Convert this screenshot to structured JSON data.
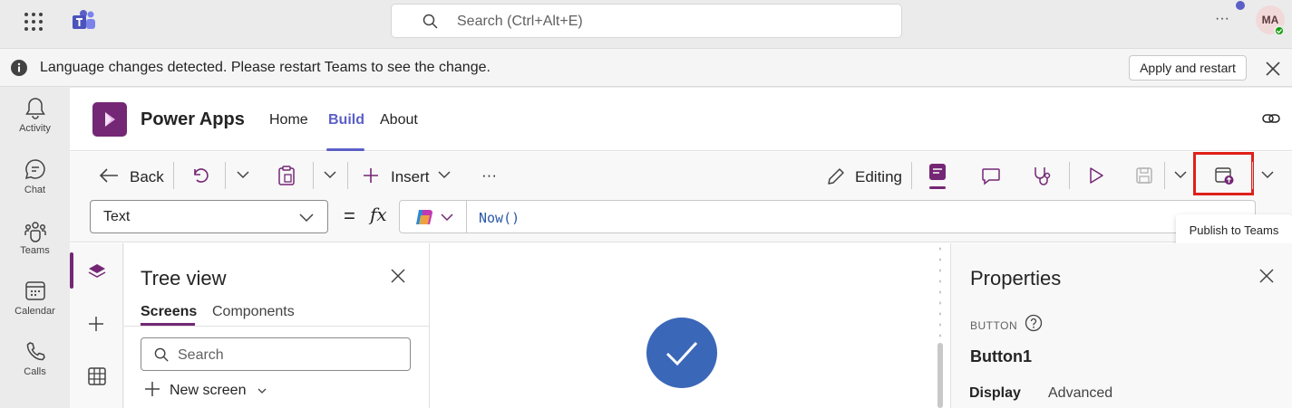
{
  "topbar": {
    "search_placeholder": "Search (Ctrl+Alt+E)",
    "more_label": "···",
    "avatar_initials": "MA"
  },
  "banner": {
    "message": "Language changes detected. Please restart Teams to see the change.",
    "apply_label": "Apply and restart"
  },
  "rail": {
    "items": [
      {
        "label": "Activity",
        "icon": "bell-icon"
      },
      {
        "label": "Chat",
        "icon": "chat-icon"
      },
      {
        "label": "Teams",
        "icon": "teams-icon"
      },
      {
        "label": "Calendar",
        "icon": "calendar-icon"
      },
      {
        "label": "Calls",
        "icon": "phone-icon"
      }
    ]
  },
  "app": {
    "name": "Power Apps",
    "tabs": [
      "Home",
      "Build",
      "About"
    ],
    "active_tab": "Build"
  },
  "toolbar": {
    "back_label": "Back",
    "insert_label": "Insert",
    "more_label": "···",
    "editing_label": "Editing",
    "publish_tooltip": "Publish to Teams"
  },
  "formula_bar": {
    "property": "Text",
    "equals": "=",
    "fx": "fx",
    "formula": "Now()"
  },
  "tree_view": {
    "title": "Tree view",
    "tabs": [
      "Screens",
      "Components"
    ],
    "search_placeholder": "Search",
    "new_screen_label": "New screen"
  },
  "properties": {
    "title": "Properties",
    "control_type": "BUTTON",
    "control_name": "Button1",
    "tabs": [
      "Display",
      "Advanced"
    ]
  },
  "colors": {
    "teams_accent": "#5b5fc7",
    "powerapps_purple": "#742774",
    "highlight_red": "#e0201b",
    "canvas_button": "#3b67b8"
  }
}
